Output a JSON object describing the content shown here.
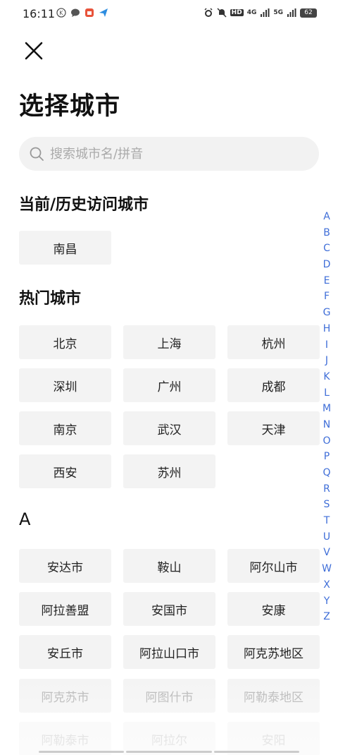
{
  "status_bar": {
    "time": "16:11",
    "network_labels": [
      "4G",
      "5G"
    ],
    "hd_label": "HD",
    "battery": "62"
  },
  "header": {
    "title": "选择城市"
  },
  "search": {
    "placeholder": "搜索城市名/拼音"
  },
  "sections": {
    "recent_title": "当前/历史访问城市",
    "recent": [
      "南昌"
    ],
    "hot_title": "热门城市",
    "hot": [
      "北京",
      "上海",
      "杭州",
      "深圳",
      "广州",
      "成都",
      "南京",
      "武汉",
      "天津",
      "西安",
      "苏州"
    ],
    "a_title": "A",
    "a_cities": [
      "安达市",
      "鞍山",
      "阿尔山市",
      "阿拉善盟",
      "安国市",
      "安康",
      "安丘市",
      "阿拉山口市",
      "阿克苏地区",
      "阿克苏市",
      "阿图什市",
      "阿勒泰地区",
      "阿勒泰市",
      "阿拉尔",
      "安阳"
    ]
  },
  "alpha_index": [
    "A",
    "B",
    "C",
    "D",
    "E",
    "F",
    "G",
    "H",
    "I",
    "J",
    "K",
    "L",
    "M",
    "N",
    "O",
    "P",
    "Q",
    "R",
    "S",
    "T",
    "U",
    "V",
    "W",
    "X",
    "Y",
    "Z"
  ],
  "colors": {
    "index": "#3f6ed8",
    "button_bg": "#f3f3f3"
  }
}
